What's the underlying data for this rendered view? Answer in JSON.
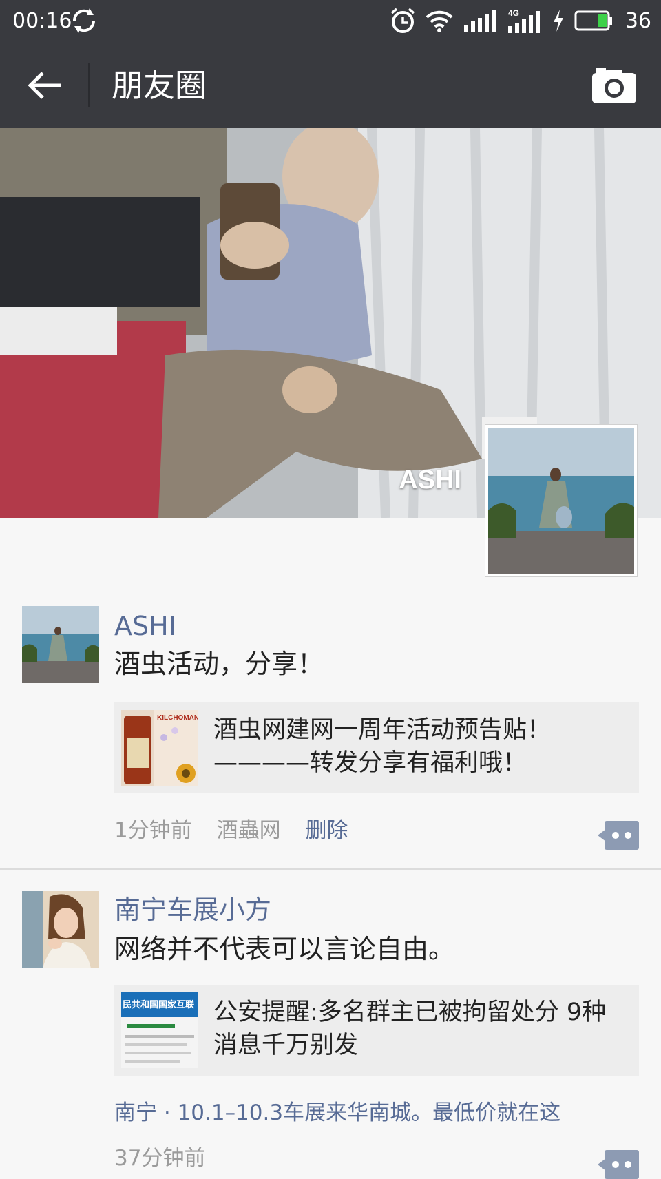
{
  "status_bar": {
    "time": "00:16",
    "network": "4G",
    "battery_level": "36",
    "icons": [
      "sync-icon",
      "alarm-icon",
      "wifi-icon",
      "signal-icon",
      "signal-4g-icon",
      "charging-icon",
      "battery-icon"
    ]
  },
  "nav": {
    "title": "朋友圈",
    "back_icon": "arrow-left-icon",
    "camera_icon": "camera-icon"
  },
  "cover": {
    "owner_name": "ASHI"
  },
  "posts": [
    {
      "author": "ASHI",
      "text": "酒虫活动，分享！",
      "share": {
        "title_line1": "酒虫网建网一周年活动预告贴！",
        "title_line2": "————转发分享有福利哦！",
        "thumb_text": "KILCHOMAN"
      },
      "time": "1分钟前",
      "source": "酒蟲网",
      "action": "删除"
    },
    {
      "author": "南宁车展小方",
      "text": "网络并不代表可以言论自由。",
      "share": {
        "title_line1": "公安提醒:多名群主已被拘留处分 9种",
        "title_line2": "消息千万别发",
        "thumb_text": "民共和国国家互联"
      },
      "location": "南宁 · 10.1–10.3车展来华南城。最低价就在这",
      "time": "37分钟前"
    }
  ],
  "colors": {
    "topbar": "#393a3f",
    "link": "#576b95",
    "background": "#f7f7f7",
    "card": "#ededed"
  }
}
